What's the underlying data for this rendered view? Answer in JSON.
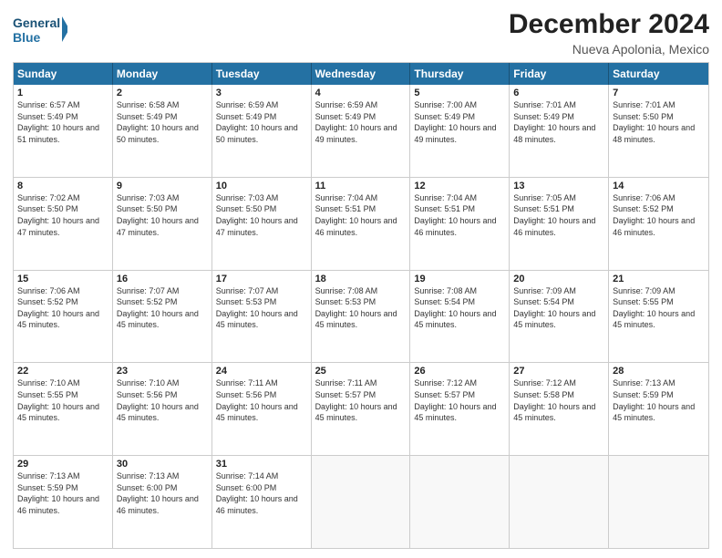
{
  "header": {
    "logo_line1": "General",
    "logo_line2": "Blue",
    "main_title": "December 2024",
    "subtitle": "Nueva Apolonia, Mexico"
  },
  "calendar": {
    "days_of_week": [
      "Sunday",
      "Monday",
      "Tuesday",
      "Wednesday",
      "Thursday",
      "Friday",
      "Saturday"
    ],
    "weeks": [
      [
        {
          "day": "1",
          "sunrise": "6:57 AM",
          "sunset": "5:49 PM",
          "daylight": "10 hours and 51 minutes."
        },
        {
          "day": "2",
          "sunrise": "6:58 AM",
          "sunset": "5:49 PM",
          "daylight": "10 hours and 50 minutes."
        },
        {
          "day": "3",
          "sunrise": "6:59 AM",
          "sunset": "5:49 PM",
          "daylight": "10 hours and 50 minutes."
        },
        {
          "day": "4",
          "sunrise": "6:59 AM",
          "sunset": "5:49 PM",
          "daylight": "10 hours and 49 minutes."
        },
        {
          "day": "5",
          "sunrise": "7:00 AM",
          "sunset": "5:49 PM",
          "daylight": "10 hours and 49 minutes."
        },
        {
          "day": "6",
          "sunrise": "7:01 AM",
          "sunset": "5:49 PM",
          "daylight": "10 hours and 48 minutes."
        },
        {
          "day": "7",
          "sunrise": "7:01 AM",
          "sunset": "5:50 PM",
          "daylight": "10 hours and 48 minutes."
        }
      ],
      [
        {
          "day": "8",
          "sunrise": "7:02 AM",
          "sunset": "5:50 PM",
          "daylight": "10 hours and 47 minutes."
        },
        {
          "day": "9",
          "sunrise": "7:03 AM",
          "sunset": "5:50 PM",
          "daylight": "10 hours and 47 minutes."
        },
        {
          "day": "10",
          "sunrise": "7:03 AM",
          "sunset": "5:50 PM",
          "daylight": "10 hours and 47 minutes."
        },
        {
          "day": "11",
          "sunrise": "7:04 AM",
          "sunset": "5:51 PM",
          "daylight": "10 hours and 46 minutes."
        },
        {
          "day": "12",
          "sunrise": "7:04 AM",
          "sunset": "5:51 PM",
          "daylight": "10 hours and 46 minutes."
        },
        {
          "day": "13",
          "sunrise": "7:05 AM",
          "sunset": "5:51 PM",
          "daylight": "10 hours and 46 minutes."
        },
        {
          "day": "14",
          "sunrise": "7:06 AM",
          "sunset": "5:52 PM",
          "daylight": "10 hours and 46 minutes."
        }
      ],
      [
        {
          "day": "15",
          "sunrise": "7:06 AM",
          "sunset": "5:52 PM",
          "daylight": "10 hours and 45 minutes."
        },
        {
          "day": "16",
          "sunrise": "7:07 AM",
          "sunset": "5:52 PM",
          "daylight": "10 hours and 45 minutes."
        },
        {
          "day": "17",
          "sunrise": "7:07 AM",
          "sunset": "5:53 PM",
          "daylight": "10 hours and 45 minutes."
        },
        {
          "day": "18",
          "sunrise": "7:08 AM",
          "sunset": "5:53 PM",
          "daylight": "10 hours and 45 minutes."
        },
        {
          "day": "19",
          "sunrise": "7:08 AM",
          "sunset": "5:54 PM",
          "daylight": "10 hours and 45 minutes."
        },
        {
          "day": "20",
          "sunrise": "7:09 AM",
          "sunset": "5:54 PM",
          "daylight": "10 hours and 45 minutes."
        },
        {
          "day": "21",
          "sunrise": "7:09 AM",
          "sunset": "5:55 PM",
          "daylight": "10 hours and 45 minutes."
        }
      ],
      [
        {
          "day": "22",
          "sunrise": "7:10 AM",
          "sunset": "5:55 PM",
          "daylight": "10 hours and 45 minutes."
        },
        {
          "day": "23",
          "sunrise": "7:10 AM",
          "sunset": "5:56 PM",
          "daylight": "10 hours and 45 minutes."
        },
        {
          "day": "24",
          "sunrise": "7:11 AM",
          "sunset": "5:56 PM",
          "daylight": "10 hours and 45 minutes."
        },
        {
          "day": "25",
          "sunrise": "7:11 AM",
          "sunset": "5:57 PM",
          "daylight": "10 hours and 45 minutes."
        },
        {
          "day": "26",
          "sunrise": "7:12 AM",
          "sunset": "5:57 PM",
          "daylight": "10 hours and 45 minutes."
        },
        {
          "day": "27",
          "sunrise": "7:12 AM",
          "sunset": "5:58 PM",
          "daylight": "10 hours and 45 minutes."
        },
        {
          "day": "28",
          "sunrise": "7:13 AM",
          "sunset": "5:59 PM",
          "daylight": "10 hours and 45 minutes."
        }
      ],
      [
        {
          "day": "29",
          "sunrise": "7:13 AM",
          "sunset": "5:59 PM",
          "daylight": "10 hours and 46 minutes."
        },
        {
          "day": "30",
          "sunrise": "7:13 AM",
          "sunset": "6:00 PM",
          "daylight": "10 hours and 46 minutes."
        },
        {
          "day": "31",
          "sunrise": "7:14 AM",
          "sunset": "6:00 PM",
          "daylight": "10 hours and 46 minutes."
        },
        null,
        null,
        null,
        null
      ]
    ]
  }
}
